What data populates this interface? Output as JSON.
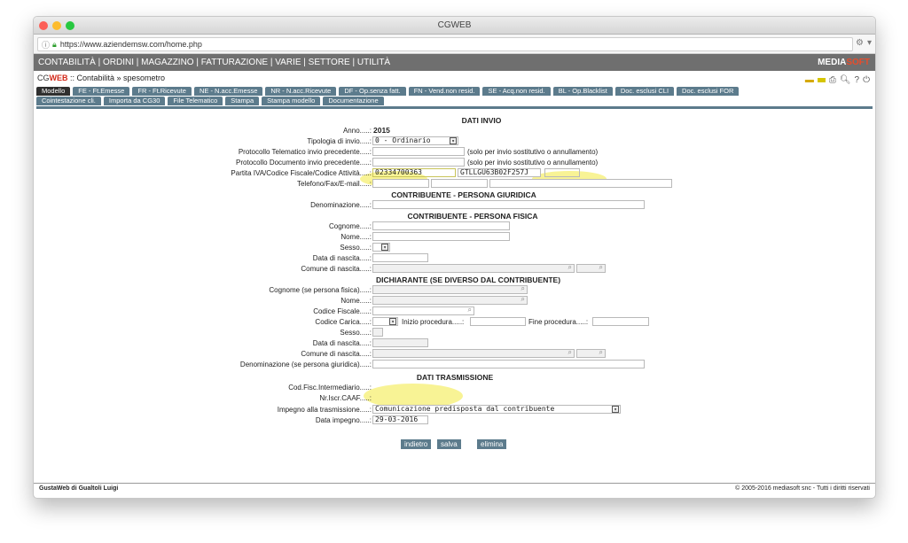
{
  "window": {
    "title": "CGWEB"
  },
  "browser": {
    "url": "https://www.aziendemsw.com/home.php"
  },
  "menu": {
    "items": "CONTABILITÀ | ORDINI | MAGAZZINO | FATTURAZIONE | VARIE | SETTORE | UTILITÀ",
    "brand_a": "MEDIA",
    "brand_b": "SOFT"
  },
  "crumb": {
    "logo_a": "CG",
    "logo_b": "WEB",
    "path": " :: Contabilità » spesometro"
  },
  "tabs": {
    "row1": [
      "Modello",
      "FE - Ft.Emesse",
      "FR - Ft.Ricevute",
      "NE - N.acc.Emesse",
      "NR - N.acc.Ricevute",
      "DF - Op.senza fatt.",
      "FN - Vend.non resid.",
      "SE - Acq.non resid.",
      "BL - Op.Blacklist",
      "Doc. esclusi CLI",
      "Doc. esclusi FOR"
    ],
    "row2": [
      "Cointestazione cli.",
      "Importa da CG30",
      "File Telematico",
      "Stampa",
      "Stampa modello",
      "Documentazione"
    ]
  },
  "form": {
    "s1": "DATI INVIO",
    "anno_label": "Anno.....:",
    "anno_value": "2015",
    "tipologia_label": "Tipologia di invio.....:",
    "tipologia_value": "0 - Ordinario",
    "prot_tel_label": "Protocollo Telematico invio precedente.....:",
    "prot_note": "(solo per invio sostitutivo o annullamento)",
    "prot_doc_label": "Protocollo Documento invio precedente.....:",
    "piva_label": "Partita IVA/Codice Fiscale/Codice Attività.....:",
    "piva_value": "02334700363",
    "cf_value": "GTLLGU63B02F257J",
    "tel_label": "Telefono/Fax/E-mail.....:",
    "s2": "CONTRIBUENTE - PERSONA GIURIDICA",
    "denom_label": "Denominazione.....:",
    "s3": "CONTRIBUENTE - PERSONA FISICA",
    "cognome_label": "Cognome.....:",
    "nome_label": "Nome.....:",
    "sesso_label": "Sesso.....:",
    "datan_label": "Data di nascita.....:",
    "comune_label": "Comune di nascita.....:",
    "s4": "DICHIARANTE (SE DIVERSO DAL CONTRIBUENTE)",
    "d_cognome_label": "Cognome (se persona fisica).....:",
    "d_nome_label": "Nome.....:",
    "d_cf_label": "Codice Fiscale.....:",
    "d_carica_label": "Codice Carica.....:",
    "inizio_label": "Inizio procedura.....:",
    "fine_label": "Fine procedura.....:",
    "d_sesso_label": "Sesso.....:",
    "d_datan_label": "Data di nascita.....:",
    "d_comune_label": "Comune di nascita.....:",
    "d_denom_label": "Denominazione (se persona giuridica).....:",
    "s5": "DATI TRASMISSIONE",
    "cfint_label": "Cod.Fisc.Intermediario.....:",
    "caaf_label": "Nr.Iscr.CAAF.....:",
    "impegno_label": "Impegno alla trasmissione.....:",
    "impegno_value": "Comunicazione predisposta dal contribuente",
    "dataimp_label": "Data impegno.....:",
    "dataimp_value": "29-03-2016"
  },
  "buttons": {
    "back": "indietro",
    "save": "salva",
    "delete": "elimina"
  },
  "footer": {
    "left": "GustaWeb di Gualtoli Luigi",
    "right": "© 2005-2016 mediasoft snc - Tutti i diritti riservati"
  }
}
